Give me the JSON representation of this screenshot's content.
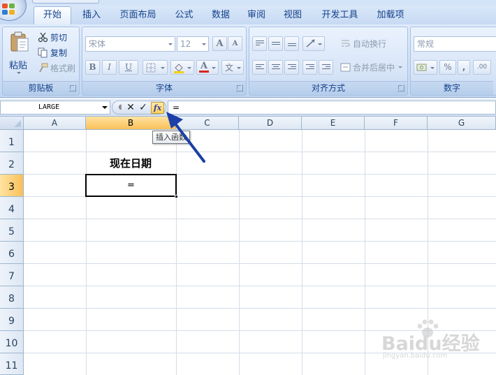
{
  "tabs": [
    "开始",
    "插入",
    "页面布局",
    "公式",
    "数据",
    "审阅",
    "视图",
    "开发工具",
    "加载项"
  ],
  "ribbon": {
    "clipboard": {
      "label": "剪贴板",
      "paste": "粘贴",
      "cut": "剪切",
      "copy": "复制",
      "format_painter": "格式刷"
    },
    "font": {
      "label": "字体",
      "font_name": "宋体",
      "font_size": "12",
      "bold": "B",
      "italic": "I",
      "underline": "U",
      "grow": "A",
      "shrink": "A",
      "font_color": "A",
      "phonetic": "文"
    },
    "alignment": {
      "label": "对齐方式",
      "wrap_text": "自动换行",
      "merge_center": "合并后居中"
    },
    "number": {
      "label": "数字",
      "format": "常规",
      "percent": "%",
      "comma": ",",
      "decimal": ".00"
    }
  },
  "formula_bar": {
    "name_box": "LARGE",
    "cancel": "✕",
    "enter": "✓",
    "fx": "fx",
    "formula": "="
  },
  "tooltip": "插入函数",
  "grid": {
    "columns": [
      "A",
      "B",
      "C",
      "D",
      "E",
      "F",
      "G"
    ],
    "rows": [
      "1",
      "2",
      "3",
      "4",
      "5",
      "6",
      "7",
      "8",
      "9",
      "10",
      "11"
    ],
    "cells": {
      "B2": "现在日期",
      "B3": "="
    }
  },
  "watermark": {
    "brand": "Baidu经验",
    "url": "jingyan.baidu.com"
  },
  "colors": {
    "accent": "#15428b",
    "selected_header": "#f9c05a",
    "annotation_arrow": "#1c3fa8"
  }
}
